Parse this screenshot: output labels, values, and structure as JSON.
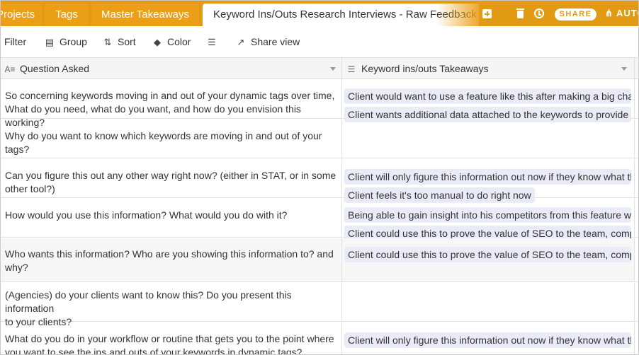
{
  "tabs": [
    {
      "label": "Projects"
    },
    {
      "label": "Tags"
    },
    {
      "label": "Master Takeaways"
    },
    {
      "label": "Keyword Ins/Outs Research Interviews - Raw Feedback"
    }
  ],
  "topbar": {
    "share_label": "SHARE",
    "auto_label": "AUTO"
  },
  "toolbar": {
    "filter_label": "Filter",
    "group_label": "Group",
    "sort_label": "Sort",
    "color_label": "Color",
    "share_view_label": "Share view"
  },
  "columns": [
    {
      "label": "Question Asked"
    },
    {
      "label": "Keyword ins/outs Takeaways"
    }
  ],
  "rows": [
    {
      "question": [
        "So concerning keywords moving in and out of your dynamic tags over time,",
        "What do you need, what do you want, and how do you envision this working?"
      ],
      "takeaways": [
        "Client would want to use a feature like this after making a big change",
        "Client wants additional data attached to the keywords to provide context"
      ]
    },
    {
      "question": [
        "Why do you want to know which keywords are moving in and out of your",
        "tags?"
      ],
      "takeaways": []
    },
    {
      "question": [
        "Can you figure this out any other way right now? (either in STAT, or in some",
        "other tool?)"
      ],
      "takeaways": [
        "Client will only figure this information out now if they know what they are looking for",
        "Client feels it's too manual to do right now"
      ]
    },
    {
      "question": [
        "How would you use this information? What would you do with it?"
      ],
      "takeaways": [
        "Being able to gain insight into his competitors from this feature would be valuable",
        "Client could use this to prove the value of SEO to the team, company"
      ]
    },
    {
      "question": [
        "Who wants this information? Who are you showing this information to? and",
        "why?"
      ],
      "takeaways": [
        "Client could use this to prove the value of SEO to the team, company"
      ]
    },
    {
      "question": [
        "(Agencies) do your clients want to know this? Do you present this information",
        "to your clients?"
      ],
      "takeaways": []
    },
    {
      "question": [
        "What do you do in your workflow or routine that gets you to the point where",
        "you want to see the ins and outs of your keywords in dynamic tags?"
      ],
      "takeaways": [
        "Client will only figure this information out now if they know what they are looking for"
      ]
    }
  ],
  "colors": {
    "accent": "#e39a13",
    "chip_bg": "#e9ebf7",
    "header_bg": "#f5f5f5"
  }
}
